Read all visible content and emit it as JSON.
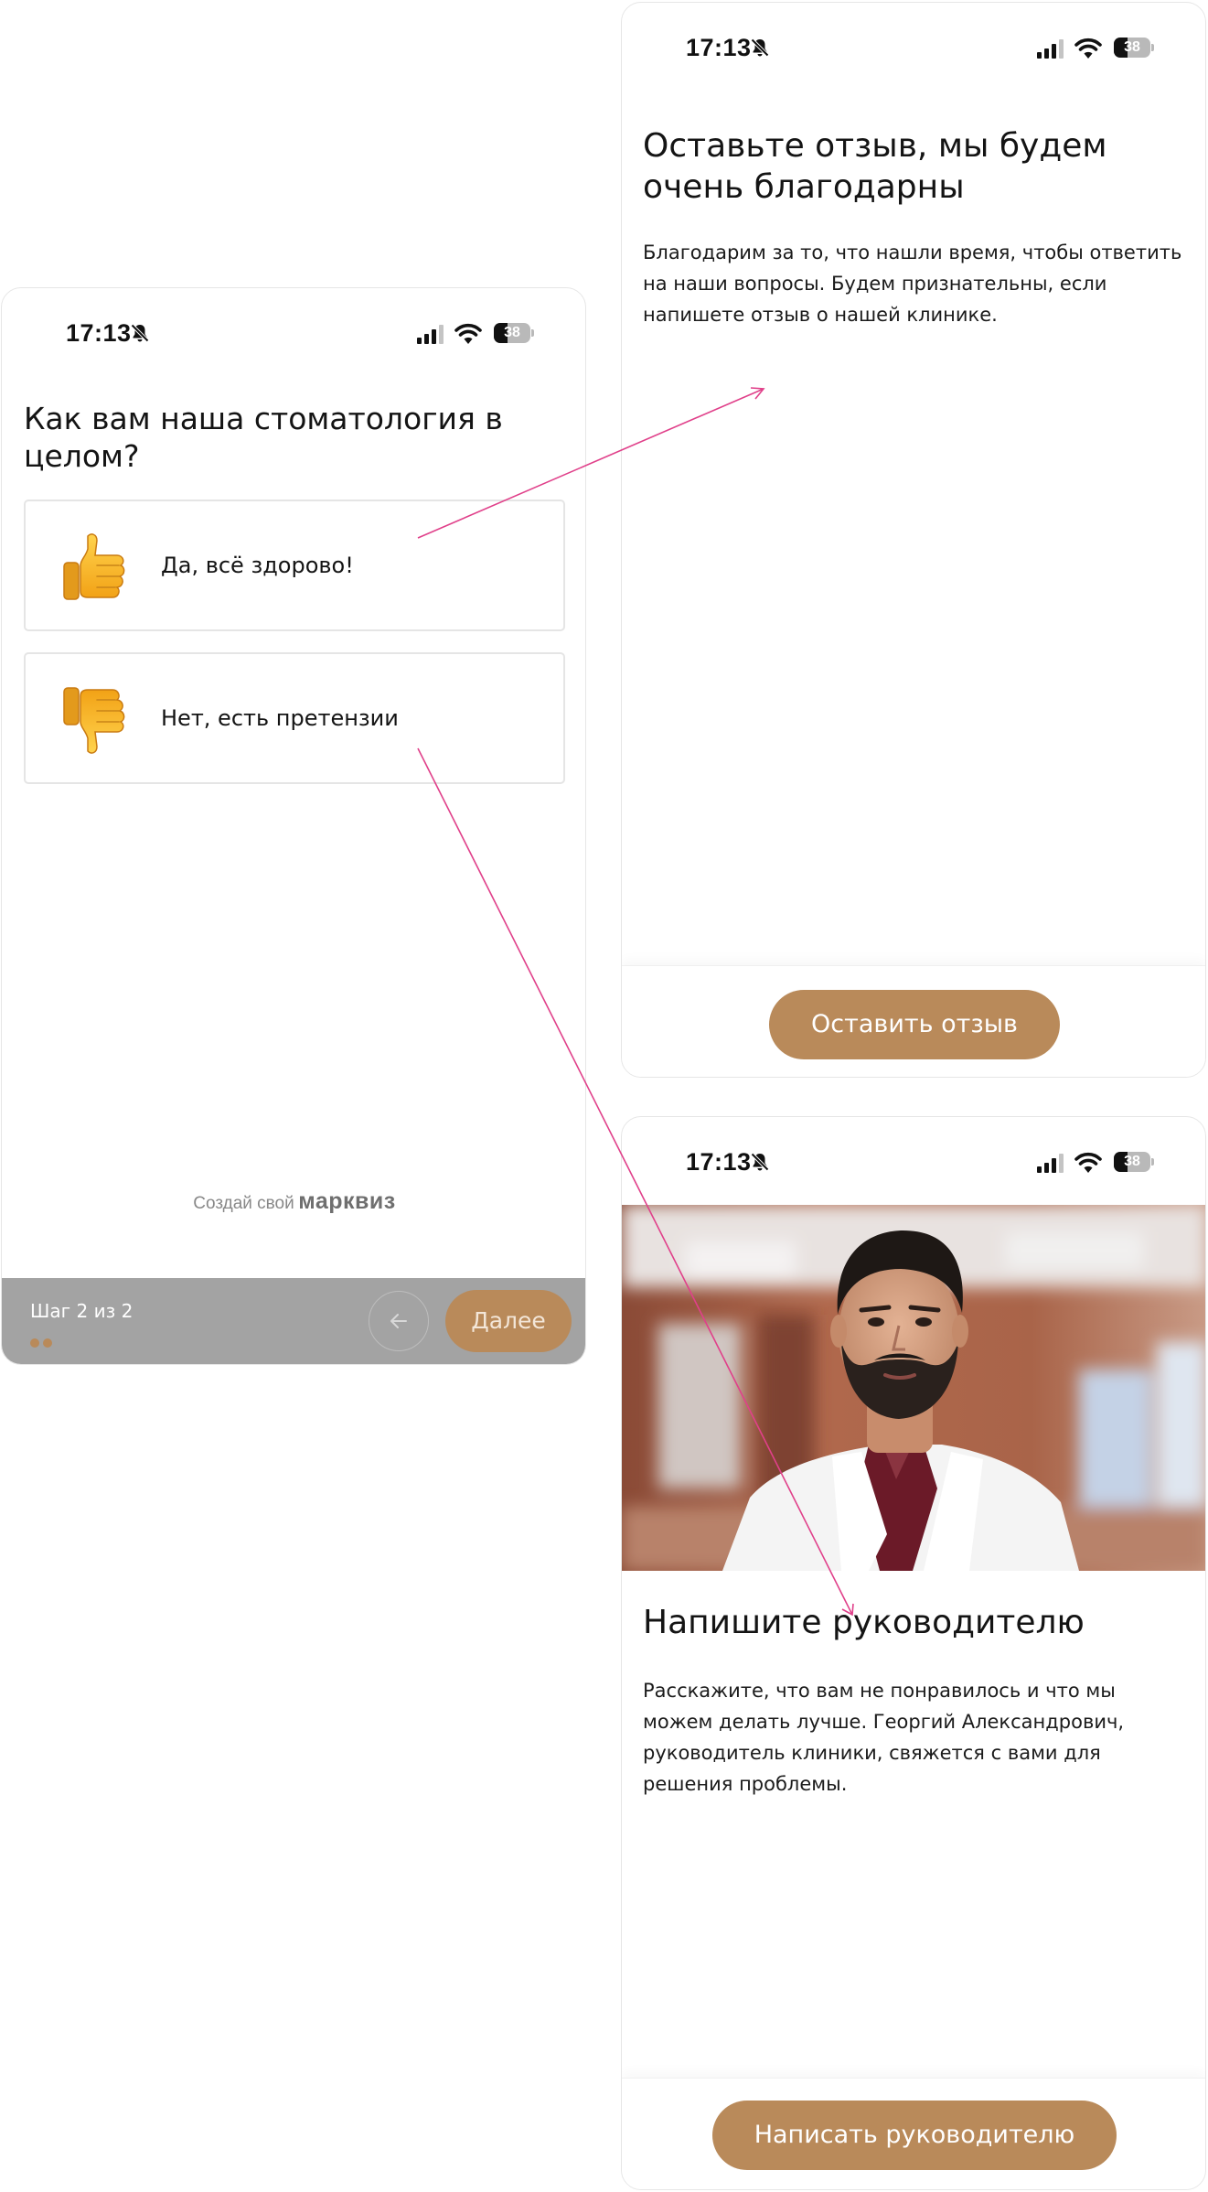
{
  "status_bar": {
    "time": "17:13",
    "battery": "38",
    "battery_level": 0.38
  },
  "left_screen": {
    "question": "Как вам наша стоматология в целом?",
    "options": [
      {
        "label": "Да, всё здорово!",
        "icon": "thumbs-up-icon"
      },
      {
        "label": "Нет, есть претензии",
        "icon": "thumbs-down-icon"
      }
    ],
    "branding_prefix": "Создай свой",
    "branding_name": "марквиз",
    "footer": {
      "step_text": "Шаг 2 из 2",
      "next_label": "Далее",
      "back_icon": "arrow-left-icon"
    }
  },
  "review_screen": {
    "title": "Оставьте отзыв, мы будем очень благодарны",
    "text": "Благодарим за то, что нашли время, чтобы ответить на наши вопросы. Будем признательны, если напишете отзыв о нашей клинике.",
    "button_label": "Оставить отзыв"
  },
  "manager_screen": {
    "title": "Напишите руководителю",
    "text": "Расскажите, что вам не понравилось и что мы можем делать лучше. Георгий Александрович, руководитель клиники, свяжется с вами для решения проблемы.",
    "button_label": "Написать руководителю"
  },
  "colors": {
    "accent": "#b98a5a",
    "arrow": "#e0408a",
    "footer": "#a3a3a3"
  }
}
